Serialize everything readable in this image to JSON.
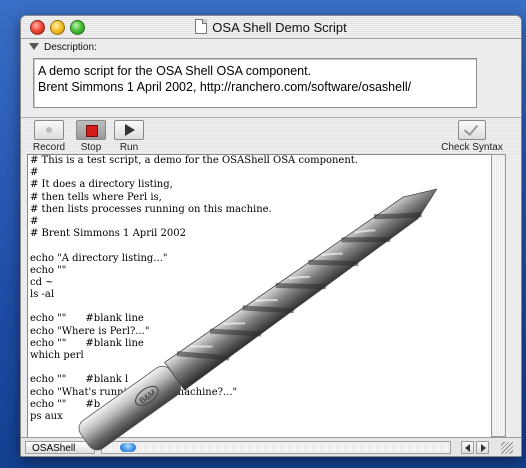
{
  "window": {
    "title": "OSA Shell Demo Script"
  },
  "description": {
    "header": "Description:",
    "lines": [
      "A demo script for the OSA Shell OSA component.",
      "Brent Simmons 1 April 2002, http://ranchero.com/software/osashell/"
    ]
  },
  "toolbar": {
    "record_label": "Record",
    "stop_label": "Stop",
    "run_label": "Run",
    "check_label": "Check Syntax"
  },
  "editor": {
    "lines": [
      "# This is a test script, a demo for the OSAShell OSA component.",
      "#",
      "# It does a directory listing,",
      "# then tells where Perl is,",
      "# then lists processes running on this machine.",
      "#",
      "# Brent Simmons 1 April 2002",
      "",
      "echo \"A directory listing...\"",
      "echo \"\"",
      "cd ~",
      "ls -al",
      "",
      "echo \"\"      #blank line",
      "echo \"Where is Perl?...\"",
      "echo \"\"      #blank line",
      "which perl",
      "",
      "echo \"\"      #blank l",
      "echo \"What's runnin             machine?...\"",
      "echo \"\"      #b",
      "ps aux"
    ]
  },
  "status": {
    "language": "OSAShell"
  },
  "overlay": {
    "drill_engraving": "B&M"
  },
  "colors": {
    "desktop": "#2a5bb5",
    "stop_red": "#d31d1d",
    "scroll_thumb": "#2d7fe0"
  }
}
